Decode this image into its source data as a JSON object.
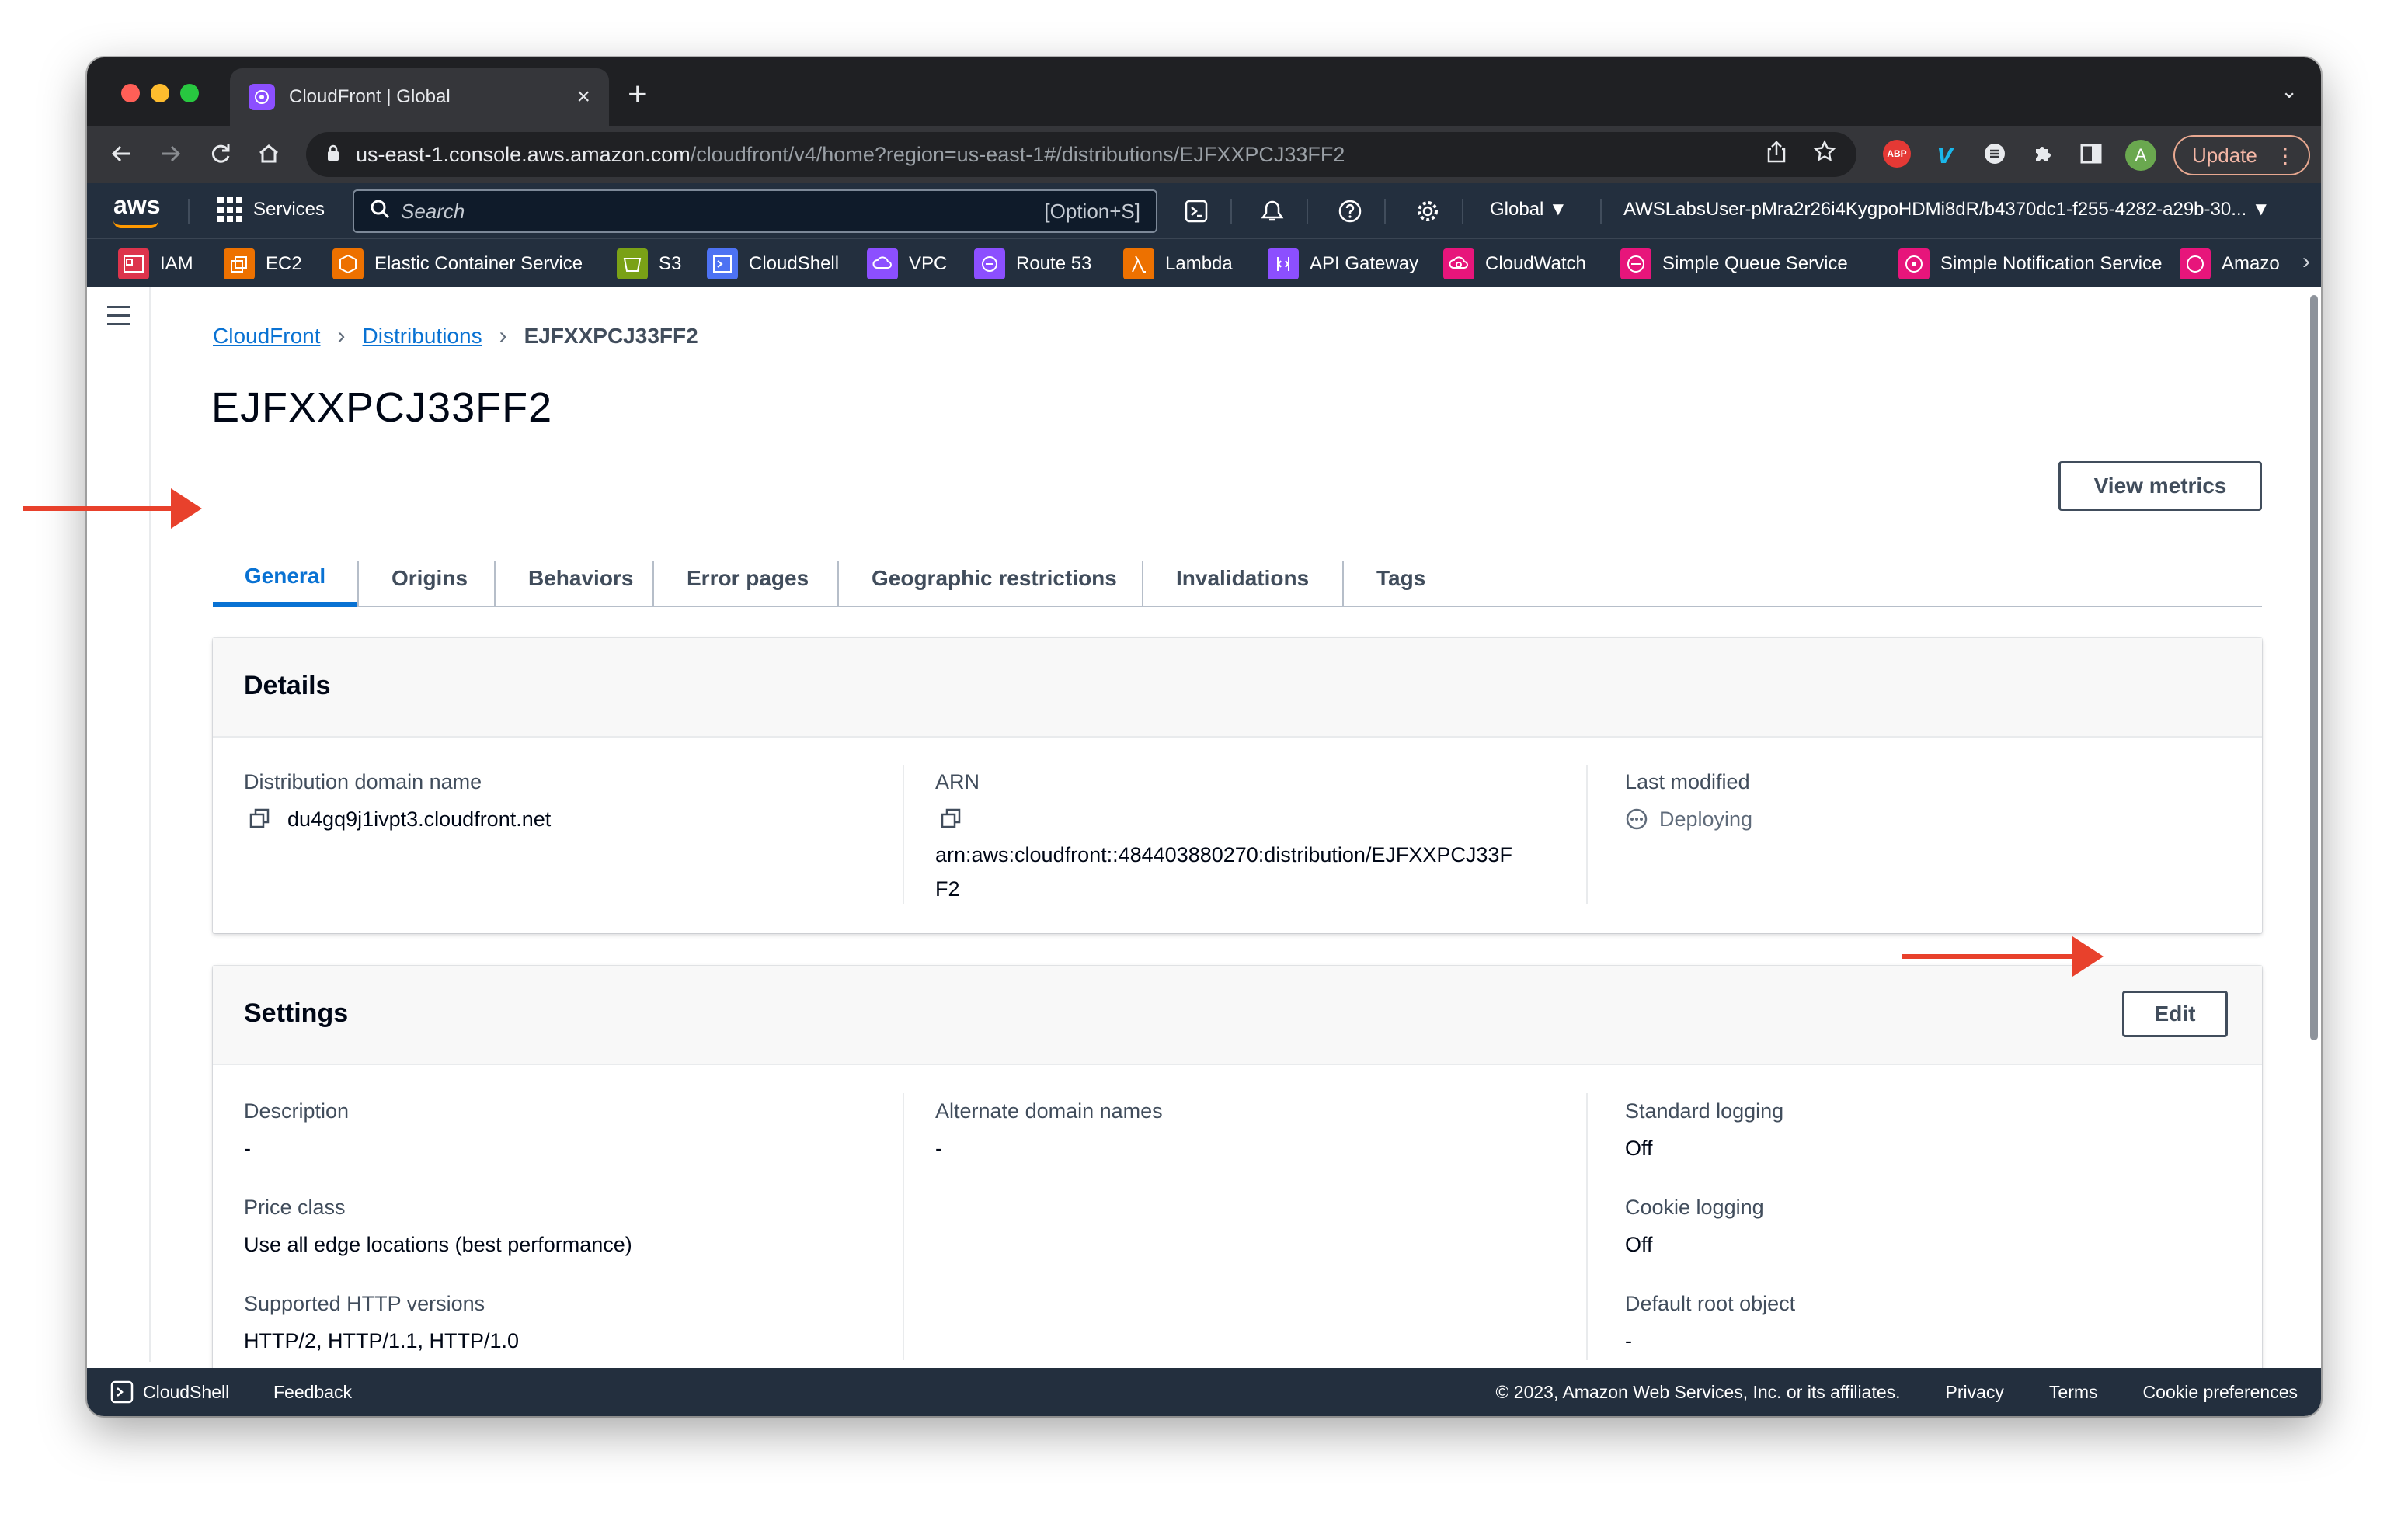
{
  "browser": {
    "tab_title": "CloudFront | Global",
    "url_host": "us-east-1.console.aws.amazon.com",
    "url_path": "/cloudfront/v4/home?region=us-east-1#/distributions/EJFXXPCJ33FF2",
    "abp_label": "ABP",
    "profile_initial": "A",
    "update_label": "Update"
  },
  "aws_header": {
    "logo_text": "aws",
    "services_label": "Services",
    "search_placeholder": "Search",
    "search_shortcut": "[Option+S]",
    "region_label": "Global ▼",
    "account_label": "AWSLabsUser-pMra2r26i4KygpoHDMi8dR/b4370dc1-f255-4282-a29b-30... ▼"
  },
  "favorites": [
    {
      "label": "IAM",
      "color": "#dd344c"
    },
    {
      "label": "EC2",
      "color": "#ed7100"
    },
    {
      "label": "Elastic Container Service",
      "color": "#ed7100"
    },
    {
      "label": "S3",
      "color": "#7aa116"
    },
    {
      "label": "CloudShell",
      "color": "#4d72f3"
    },
    {
      "label": "VPC",
      "color": "#8c4fff"
    },
    {
      "label": "Route 53",
      "color": "#8c4fff"
    },
    {
      "label": "Lambda",
      "color": "#ed7100"
    },
    {
      "label": "API Gateway",
      "color": "#8c4fff"
    },
    {
      "label": "CloudWatch",
      "color": "#e7157b"
    },
    {
      "label": "Simple Queue Service",
      "color": "#e7157b"
    },
    {
      "label": "Simple Notification Service",
      "color": "#e7157b"
    },
    {
      "label": "Amazo",
      "color": "#e7157b"
    }
  ],
  "breadcrumb": {
    "root": "CloudFront",
    "parent": "Distributions",
    "current": "EJFXXPCJ33FF2"
  },
  "page_title": "EJFXXPCJ33FF2",
  "view_metrics_label": "View metrics",
  "tabs": [
    "General",
    "Origins",
    "Behaviors",
    "Error pages",
    "Geographic restrictions",
    "Invalidations",
    "Tags"
  ],
  "details": {
    "title": "Details",
    "domain_label": "Distribution domain name",
    "domain_value": "du4gq9j1ivpt3.cloudfront.net",
    "arn_label": "ARN",
    "arn_line1": "arn:aws:cloudfront::484403880270:distribution/EJFXXPCJ33F",
    "arn_line2": "F2",
    "modified_label": "Last modified",
    "modified_value": "Deploying"
  },
  "settings": {
    "title": "Settings",
    "edit_label": "Edit",
    "description_label": "Description",
    "description_value": "-",
    "price_class_label": "Price class",
    "price_class_value": "Use all edge locations (best performance)",
    "http_versions_label": "Supported HTTP versions",
    "http_versions_value": "HTTP/2, HTTP/1.1, HTTP/1.0",
    "alt_domain_label": "Alternate domain names",
    "alt_domain_value": "-",
    "std_logging_label": "Standard logging",
    "std_logging_value": "Off",
    "cookie_logging_label": "Cookie logging",
    "cookie_logging_value": "Off",
    "root_object_label": "Default root object",
    "root_object_value": "-"
  },
  "footer": {
    "cloudshell": "CloudShell",
    "feedback": "Feedback",
    "copyright": "© 2023, Amazon Web Services, Inc. or its affiliates.",
    "privacy": "Privacy",
    "terms": "Terms",
    "cookie_prefs": "Cookie preferences"
  },
  "colors": {
    "accent": "#0972d3",
    "annotation_arrow": "#e8412c",
    "aws_nav": "#232f3e"
  }
}
